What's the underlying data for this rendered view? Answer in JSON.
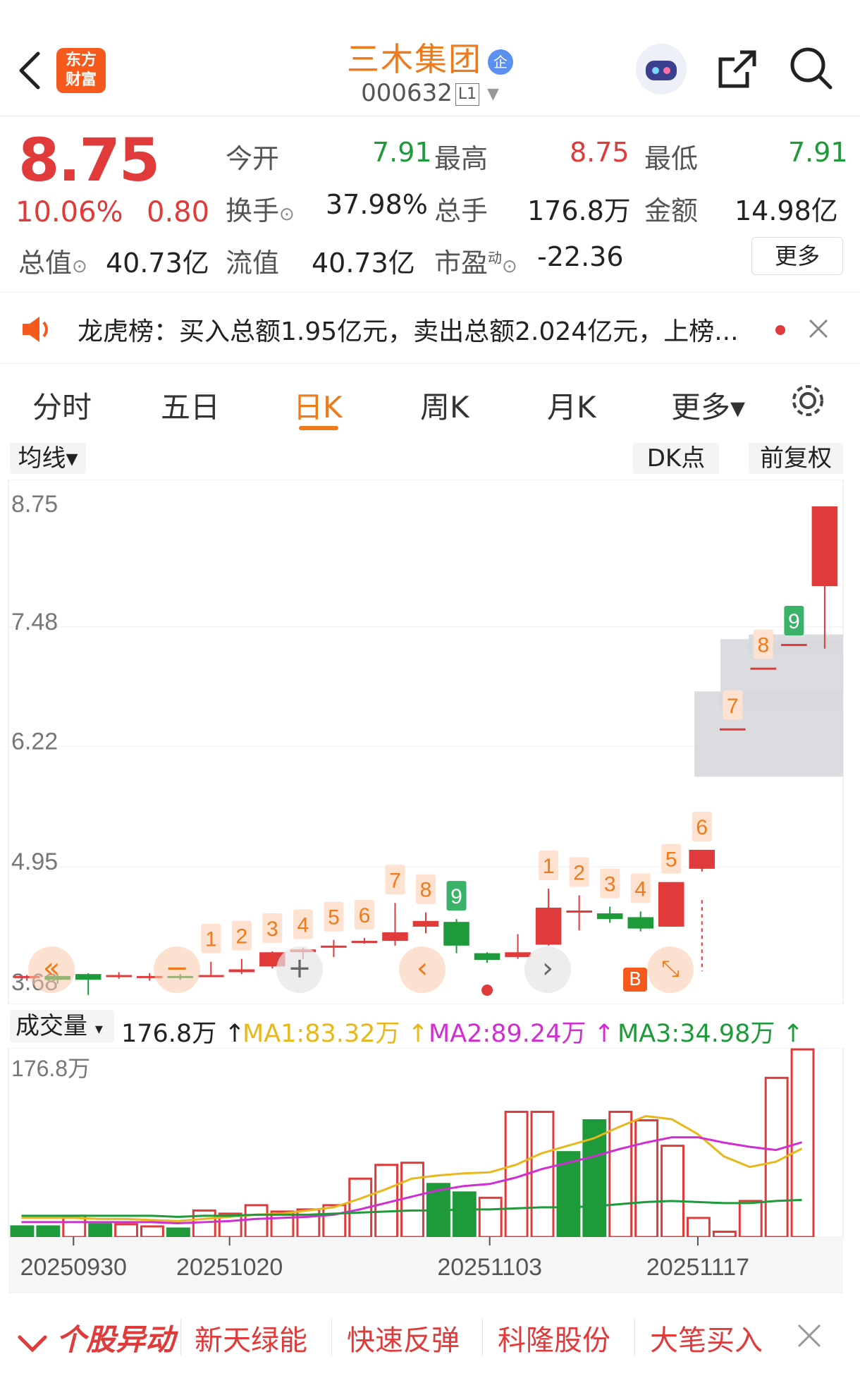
{
  "header": {
    "logo_line1": "东方",
    "logo_line2": "财富",
    "stock_name": "三木集团",
    "badge": "企",
    "stock_code": "000632",
    "level": "L1"
  },
  "quote": {
    "price": "8.75",
    "change_pct": "10.06%",
    "change_amt": "0.80",
    "open_label": "今开",
    "open": "7.91",
    "high_label": "最高",
    "high": "8.75",
    "low_label": "最低",
    "low": "7.91",
    "turnover_label": "换手",
    "turnover": "37.98%",
    "volume_label": "总手",
    "volume": "176.8万",
    "amount_label": "金额",
    "amount": "14.98亿",
    "total_mv_label": "总值",
    "total_mv": "40.73亿",
    "float_mv_label": "流值",
    "float_mv": "40.73亿",
    "pe_label": "市盈",
    "pe_sup": "动",
    "pe": "-22.36",
    "more_button": "更多"
  },
  "news": {
    "text": "龙虎榜：买入总额1.95亿元，卖出总额2.024亿元，上榜..."
  },
  "tabs": [
    {
      "label": "分时"
    },
    {
      "label": "五日"
    },
    {
      "label": "日K"
    },
    {
      "label": "周K"
    },
    {
      "label": "月K"
    },
    {
      "label": "更多▾"
    }
  ],
  "chart_controls": {
    "ma_selector": "均线▾",
    "dk_point": "DK点",
    "adjust": "前复权"
  },
  "buy_marker": "B",
  "volume_header": {
    "selector": "成交量",
    "vol": "176.8万 ↑",
    "ma1": "MA1:83.32万 ↑",
    "ma2": "MA2:89.24万 ↑",
    "ma3": "MA3:34.98万 ↑"
  },
  "colors": {
    "up": "#e03a3a",
    "down": "#1f9a3b",
    "accent": "#f07a1a",
    "ma1": "#e7b81c",
    "ma2": "#cf2ed0",
    "ma3": "#1f9a3b"
  },
  "footer": {
    "badge": "个股异动",
    "items": [
      "新天绿能",
      "快速反弹",
      "科隆股份",
      "大笔买入"
    ]
  },
  "chart_data": [
    {
      "type": "candlestick",
      "y_ticks": [
        "8.75",
        "7.48",
        "6.22",
        "4.95",
        "3.68"
      ],
      "ylim": [
        3.68,
        8.75
      ],
      "candles": [
        {
          "o": 3.78,
          "c": 3.8,
          "h": 3.81,
          "l": 3.75
        },
        {
          "o": 3.8,
          "c": 3.76,
          "h": 3.82,
          "l": 3.72
        },
        {
          "o": 3.82,
          "c": 3.76,
          "h": 3.83,
          "l": 3.6
        },
        {
          "o": 3.79,
          "c": 3.81,
          "h": 3.84,
          "l": 3.77
        },
        {
          "o": 3.8,
          "c": 3.8,
          "h": 3.83,
          "l": 3.75
        },
        {
          "o": 3.8,
          "c": 3.79,
          "h": 3.82,
          "l": 3.76
        },
        {
          "o": 3.79,
          "c": 3.81,
          "h": 3.95,
          "l": 3.79
        },
        {
          "o": 3.84,
          "c": 3.87,
          "h": 3.98,
          "l": 3.82
        },
        {
          "o": 3.9,
          "c": 4.05,
          "h": 4.06,
          "l": 3.88
        },
        {
          "o": 4.05,
          "c": 4.08,
          "h": 4.1,
          "l": 3.98
        },
        {
          "o": 4.1,
          "c": 4.12,
          "h": 4.18,
          "l": 4.0
        },
        {
          "o": 4.16,
          "c": 4.17,
          "h": 4.2,
          "l": 4.14
        },
        {
          "o": 4.17,
          "c": 4.26,
          "h": 4.57,
          "l": 4.12
        },
        {
          "o": 4.32,
          "c": 4.38,
          "h": 4.47,
          "l": 4.25
        },
        {
          "o": 4.37,
          "c": 4.12,
          "h": 4.4,
          "l": 4.04
        },
        {
          "o": 4.04,
          "c": 3.97,
          "h": 4.05,
          "l": 3.94
        },
        {
          "o": 4.0,
          "c": 4.05,
          "h": 4.24,
          "l": 3.98
        },
        {
          "o": 4.13,
          "c": 4.52,
          "h": 4.72,
          "l": 4.12
        },
        {
          "o": 4.49,
          "c": 4.49,
          "h": 4.65,
          "l": 4.28
        },
        {
          "o": 4.46,
          "c": 4.4,
          "h": 4.53,
          "l": 4.36
        },
        {
          "o": 4.42,
          "c": 4.3,
          "h": 4.48,
          "l": 4.27
        },
        {
          "o": 4.32,
          "c": 4.79,
          "h": 4.79,
          "l": 4.32
        },
        {
          "o": 4.93,
          "c": 5.13,
          "h": 5.13,
          "l": 4.9
        },
        {
          "o": 6.41,
          "c": 6.41,
          "h": 6.41,
          "l": 6.41
        },
        {
          "o": 7.05,
          "c": 7.05,
          "h": 7.05,
          "l": 7.05
        },
        {
          "o": 7.3,
          "c": 7.3,
          "h": 7.3,
          "l": 7.3
        },
        {
          "o": 7.91,
          "c": 8.75,
          "h": 8.75,
          "l": 7.25
        }
      ],
      "td_labels": [
        {
          "i": 6,
          "t": "1"
        },
        {
          "i": 7,
          "t": "2"
        },
        {
          "i": 8,
          "t": "3"
        },
        {
          "i": 9,
          "t": "4"
        },
        {
          "i": 10,
          "t": "5"
        },
        {
          "i": 11,
          "t": "6"
        },
        {
          "i": 12,
          "t": "7"
        },
        {
          "i": 13,
          "t": "8"
        },
        {
          "i": 14,
          "t": "9",
          "g": true
        },
        {
          "i": 17,
          "t": "1"
        },
        {
          "i": 18,
          "t": "2"
        },
        {
          "i": 19,
          "t": "3"
        },
        {
          "i": 20,
          "t": "4"
        },
        {
          "i": 21,
          "t": "5"
        },
        {
          "i": 22,
          "t": "6"
        },
        {
          "i": 23,
          "t": "7"
        },
        {
          "i": 24,
          "t": "8"
        },
        {
          "i": 25,
          "t": "9",
          "g": true
        }
      ]
    },
    {
      "type": "bar",
      "title": "成交量",
      "ylabel_top": "176.8万",
      "x_labels": [
        "20250930",
        "20251020",
        "20251103",
        "20251117"
      ],
      "ylim": [
        0,
        176.8
      ],
      "volumes": [
        10,
        10,
        20,
        12,
        12,
        10,
        8,
        25,
        22,
        30,
        24,
        26,
        30,
        55,
        68,
        70,
        50,
        42,
        37,
        118,
        118,
        80,
        110,
        118,
        110,
        86,
        18,
        5,
        34,
        150,
        176.8
      ],
      "up": [
        false,
        false,
        true,
        false,
        true,
        true,
        false,
        true,
        true,
        true,
        true,
        true,
        true,
        true,
        true,
        true,
        false,
        false,
        true,
        true,
        true,
        false,
        false,
        true,
        true,
        true,
        true,
        true,
        true,
        true,
        true
      ],
      "ma1": [
        18,
        18,
        18,
        17,
        17,
        16,
        15,
        17,
        19,
        21,
        22,
        25,
        28,
        36,
        45,
        55,
        58,
        60,
        61,
        68,
        79,
        86,
        93,
        104,
        114,
        111,
        97,
        76,
        66,
        71,
        83.32
      ],
      "ma2": [
        14,
        14,
        14,
        14,
        14,
        14,
        13,
        14,
        15,
        17,
        18,
        19,
        21,
        26,
        32,
        38,
        44,
        48,
        50,
        56,
        64,
        70,
        76,
        83,
        89,
        94,
        94,
        89,
        85,
        82,
        89.24
      ],
      "ma3": [
        20,
        20,
        20,
        20,
        20,
        20,
        19,
        20,
        20,
        21,
        21,
        21,
        22,
        23,
        24,
        25,
        25,
        26,
        26,
        27,
        28,
        28,
        29,
        31,
        33,
        34,
        33,
        32,
        32,
        34,
        34.98
      ]
    }
  ]
}
